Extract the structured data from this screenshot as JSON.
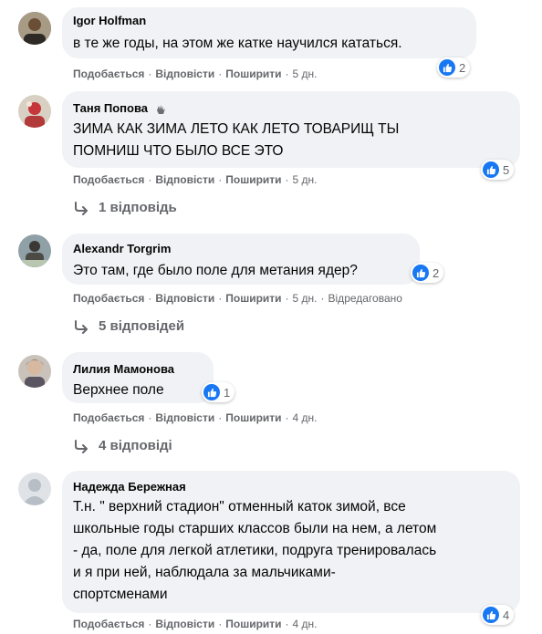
{
  "actions": {
    "like": "Подобається",
    "reply": "Відповісти",
    "share": "Поширити",
    "separator": "·"
  },
  "comments": [
    {
      "author": "Igor Holfman",
      "text": "в те же годы, на этом же катке научился кататься.",
      "reactions": "2",
      "time": "5 дн."
    },
    {
      "author": "Таня Попова",
      "text": "ЗИМА КАК ЗИМА ЛЕТО КАК ЛЕТО ТОВАРИЩ ТЫ\nПОМНИШ ЧТО БЫЛО ВСЕ ЭТО",
      "reactions": "5",
      "time": "5 дн.",
      "replies": "1 відповідь"
    },
    {
      "author": "Alexandr Torgrim",
      "text": "Это там, где было поле для метания ядер?",
      "reactions": "2",
      "time": "5 дн.",
      "edited": "Відредаговано",
      "replies": "5 відповідей"
    },
    {
      "author": "Лилия Мамонова",
      "text": "Верхнее поле",
      "reactions": "1",
      "time": "4 дн.",
      "replies": "4 відповіді"
    },
    {
      "author": "Надежда Бережная",
      "text": "Т.н. \" верхний стадион\" отменный каток зимой, все\nшкольные годы старших классов были на нем, а летом\n- да, поле для легкой атлетики, подруга тренировалась\nи я при ней, наблюдала за мальчиками-\nспортсменами",
      "reactions": "4",
      "time": "4 дн."
    }
  ],
  "colors": {
    "bubble": "#f0f2f5",
    "like_blue": "#1877f2",
    "meta_grey": "#65676b"
  }
}
